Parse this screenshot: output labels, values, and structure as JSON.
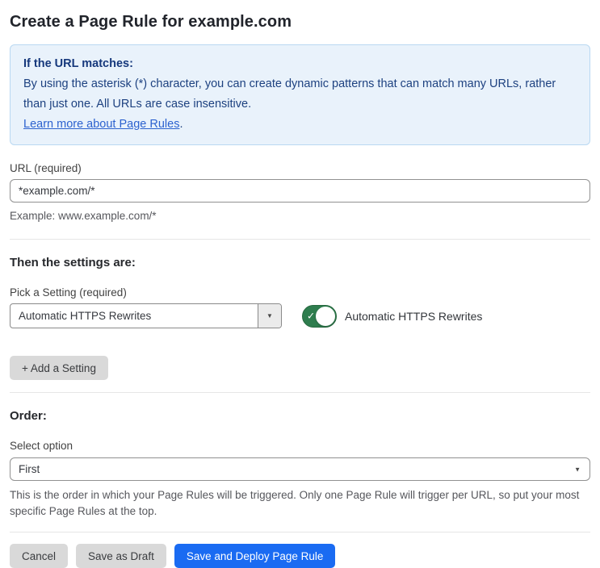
{
  "page": {
    "title": "Create a Page Rule for example.com"
  },
  "info_box": {
    "heading": "If the URL matches:",
    "body": "By using the asterisk (*) character, you can create dynamic patterns that can match many URLs, rather than just one. All URLs are case insensitive.",
    "link_label": "Learn more about Page Rules",
    "link_suffix": "."
  },
  "url_field": {
    "label": "URL (required)",
    "value": "*example.com/*",
    "helper": "Example: www.example.com/*"
  },
  "settings_section": {
    "heading": "Then the settings are:",
    "picker_label": "Pick a Setting (required)",
    "picker_value": "Automatic HTTPS Rewrites",
    "toggle_state": "on",
    "toggle_label": "Automatic HTTPS Rewrites",
    "add_setting_label": "+ Add a Setting"
  },
  "order_section": {
    "heading": "Order:",
    "select_label": "Select option",
    "select_value": "First",
    "helper": "This is the order in which your Page Rules will be triggered. Only one Page Rule will trigger per URL, so put your most specific Page Rules at the top."
  },
  "footer": {
    "cancel_label": "Cancel",
    "save_draft_label": "Save as Draft",
    "save_deploy_label": "Save and Deploy Page Rule"
  },
  "icons": {
    "dropdown_caret": "▼",
    "select_caret": "▼",
    "toggle_check": "✓"
  },
  "colors": {
    "accent_blue": "#1a6bf2",
    "toggle_green": "#2e7d4e",
    "toggle_green_border": "#27693f",
    "info_bg": "#e9f2fb",
    "info_border": "#b9d8f2",
    "info_text": "#1d4180",
    "link_blue": "#2c62cf",
    "divider": "#e6e6e6",
    "field_border": "#919191",
    "gray_btn": "#d9d9d9"
  }
}
